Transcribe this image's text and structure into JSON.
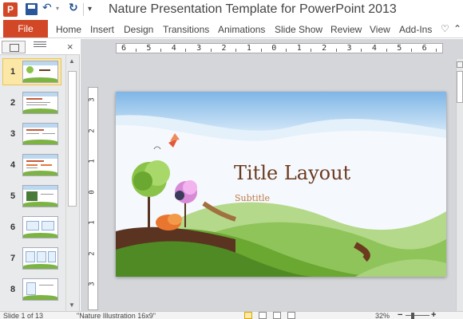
{
  "window": {
    "title": "Nature Presentation Template for PowerPoint 2013",
    "app_icon_letter": "P"
  },
  "qat": {
    "save_icon": "save-icon",
    "undo_glyph": "↶",
    "redo_glyph": "↻",
    "customize_glyph": "▾"
  },
  "ribbon": {
    "file_label": "File",
    "tabs": [
      "Home",
      "Insert",
      "Design",
      "Transitions",
      "Animations",
      "Slide Show",
      "Review",
      "View",
      "Add-Ins"
    ],
    "help_glyph": "♡",
    "collapse_glyph": "⌃"
  },
  "thumbnail_pane": {
    "close_glyph": "×",
    "slides": [
      {
        "number": "1",
        "active": true
      },
      {
        "number": "2",
        "active": false
      },
      {
        "number": "3",
        "active": false
      },
      {
        "number": "4",
        "active": false
      },
      {
        "number": "5",
        "active": false
      },
      {
        "number": "6",
        "active": false
      },
      {
        "number": "7",
        "active": false
      },
      {
        "number": "8",
        "active": false
      }
    ]
  },
  "ruler": {
    "horizontal": [
      "6",
      "5",
      "4",
      "3",
      "2",
      "1",
      "0",
      "1",
      "2",
      "3",
      "4",
      "5",
      "6"
    ],
    "vertical": [
      "3",
      "2",
      "1",
      "0",
      "1",
      "2",
      "3"
    ]
  },
  "slide": {
    "title": "Title Layout",
    "subtitle": "Subtitle"
  },
  "status": {
    "slide_info": "Slide 1 of 13",
    "theme": "\"Nature Illustration 16x9\"",
    "zoom": "32%"
  },
  "colors": {
    "accent": "#d24726",
    "sky": "#a9cff0",
    "grass_light": "#9acd32",
    "grass_dark": "#5b9a2a",
    "title_brown": "#6b3a1f"
  }
}
